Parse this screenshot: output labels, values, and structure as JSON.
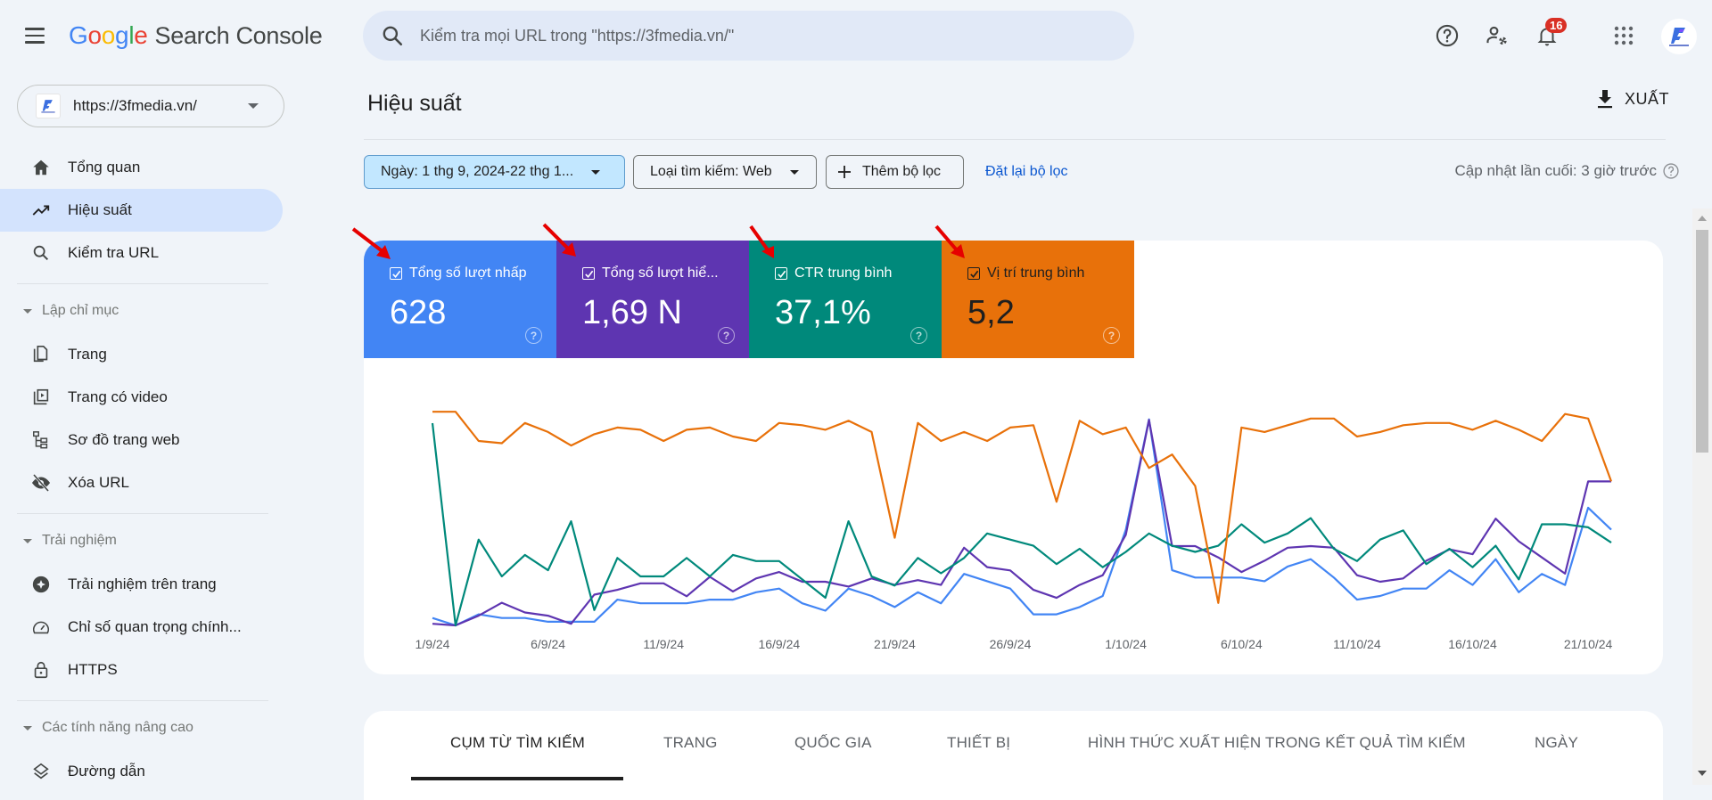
{
  "app": {
    "logo_google": [
      {
        "ch": "G",
        "color": "#4285f4"
      },
      {
        "ch": "o",
        "color": "#ea4335"
      },
      {
        "ch": "o",
        "color": "#fbbc05"
      },
      {
        "ch": "g",
        "color": "#4285f4"
      },
      {
        "ch": "l",
        "color": "#34a853"
      },
      {
        "ch": "e",
        "color": "#ea4335"
      }
    ],
    "product_name": "Search Console"
  },
  "search": {
    "placeholder": "Kiểm tra mọi URL trong \"https://3fmedia.vn/\""
  },
  "top_icons": {
    "help": "help-icon",
    "manage_users": "manage-users-icon",
    "notifications": "bell-icon",
    "notification_count": "16",
    "apps": "apps-grid-icon",
    "account": "account-avatar"
  },
  "property": {
    "url": "https://3fmedia.vn/"
  },
  "sidebar": {
    "items": [
      {
        "label": "Tổng quan",
        "icon": "home-icon"
      },
      {
        "label": "Hiệu suất",
        "icon": "trending-up-icon",
        "active": true
      },
      {
        "label": "Kiểm tra URL",
        "icon": "search-icon"
      }
    ],
    "sections": [
      {
        "title": "Lập chỉ mục",
        "items": [
          {
            "label": "Trang",
            "icon": "pages-icon"
          },
          {
            "label": "Trang có video",
            "icon": "video-pages-icon"
          },
          {
            "label": "Sơ đồ trang web",
            "icon": "sitemap-icon"
          },
          {
            "label": "Xóa URL",
            "icon": "removals-icon"
          }
        ]
      },
      {
        "title": "Trải nghiệm",
        "items": [
          {
            "label": "Trải nghiệm trên trang",
            "icon": "page-experience-icon"
          },
          {
            "label": "Chỉ số quan trọng chính...",
            "icon": "speed-gauge-icon"
          },
          {
            "label": "HTTPS",
            "icon": "lock-icon"
          }
        ]
      },
      {
        "title": "Các tính năng nâng cao",
        "items": [
          {
            "label": "Đường dẫn",
            "icon": "breadcrumbs-layers-icon"
          }
        ]
      }
    ]
  },
  "main": {
    "title": "Hiệu suất",
    "export_label": "XUẤT",
    "filters": {
      "date": "Ngày: 1 thg 9, 2024-22 thg 1...",
      "search_type": "Loại tìm kiếm: Web",
      "add_filter": "Thêm bộ lọc",
      "reset": "Đặt lại bộ lọc"
    },
    "last_updated": "Cập nhật lần cuối: 3 giờ trước",
    "metrics": [
      {
        "label": "Tổng số lượt nhấp",
        "value": "628",
        "checked": true,
        "color": "#4285f4",
        "text_color": "#ffffff"
      },
      {
        "label": "Tổng số lượt hiể...",
        "value": "1,69 N",
        "checked": true,
        "color": "#5e35b1",
        "text_color": "#ffffff"
      },
      {
        "label": "CTR trung bình",
        "value": "37,1%",
        "checked": true,
        "color": "#00897b",
        "text_color": "#ffffff"
      },
      {
        "label": "Vị trí trung bình",
        "value": "5,2",
        "checked": true,
        "color": "#e8710a",
        "text_color": "#1f1f1f"
      }
    ],
    "tabs": [
      {
        "label": "CỤM TỪ TÌM KIẾM",
        "active": true
      },
      {
        "label": "TRANG"
      },
      {
        "label": "QUỐC GIA"
      },
      {
        "label": "THIẾT BỊ"
      },
      {
        "label": "HÌNH THỨC XUẤT HIỆN TRONG KẾT QUẢ TÌM KIẾM"
      },
      {
        "label": "NGÀY"
      }
    ]
  },
  "chart_data": {
    "type": "line",
    "title": "",
    "xlabel": "",
    "ylabel": "",
    "grid": false,
    "legend": "metric cards above chart",
    "x_tick_labels": [
      "1/9/24",
      "6/9/24",
      "11/9/24",
      "16/9/24",
      "21/9/24",
      "26/9/24",
      "1/10/24",
      "6/10/24",
      "11/10/24",
      "16/10/24",
      "21/10/24"
    ],
    "x_range": [
      "1/9/24",
      "22/10/24"
    ],
    "point_count": 52,
    "series": [
      {
        "name": "Tổng số lượt nhấp",
        "color": "#4285f4",
        "axis": "clicks",
        "values": [
          4,
          2,
          5,
          4,
          4,
          3,
          3,
          3,
          9,
          8,
          8,
          8,
          9,
          9,
          11,
          12,
          8,
          6,
          12,
          10,
          7,
          11,
          8,
          16,
          14,
          12,
          5,
          5,
          7,
          10,
          28,
          58,
          17,
          15,
          15,
          15,
          14,
          18,
          20,
          15,
          9,
          10,
          12,
          12,
          17,
          13,
          20,
          11,
          16,
          13,
          34,
          28
        ]
      },
      {
        "name": "Tổng số lượt hiển thị",
        "color": "#5e35b1",
        "axis": "impressions",
        "values": [
          9,
          8,
          14,
          22,
          16,
          14,
          9,
          27,
          30,
          34,
          34,
          26,
          38,
          29,
          37,
          41,
          35,
          35,
          32,
          37,
          33,
          36,
          33,
          56,
          44,
          42,
          30,
          25,
          33,
          39,
          64,
          135,
          57,
          57,
          50,
          41,
          48,
          56,
          57,
          56,
          39,
          35,
          37,
          48,
          55,
          52,
          74,
          60,
          50,
          40,
          97,
          97
        ]
      },
      {
        "name": "CTR trung bình",
        "color": "#00897b",
        "axis": "ctr_percent",
        "values": [
          80,
          14,
          42,
          30,
          37,
          32,
          48,
          19,
          36,
          30,
          30,
          36,
          30,
          37,
          35,
          35,
          29,
          23,
          48,
          30,
          27,
          36,
          31,
          36,
          44,
          42,
          40,
          34,
          39,
          33,
          38,
          44,
          40,
          38,
          40,
          47,
          41,
          44,
          49,
          39,
          35,
          42,
          45,
          34,
          39,
          33,
          40,
          29,
          47,
          47,
          46,
          41
        ]
      },
      {
        "name": "Vị trí trung bình",
        "color": "#e8710a",
        "axis": "position",
        "values": [
          3.0,
          3.0,
          4.3,
          4.4,
          3.5,
          3.9,
          4.5,
          4.0,
          3.7,
          3.8,
          4.3,
          3.8,
          3.7,
          4.1,
          4.3,
          3.5,
          3.6,
          3.8,
          3.4,
          3.9,
          8.6,
          3.5,
          4.3,
          3.9,
          4.3,
          3.7,
          3.6,
          7.0,
          3.4,
          4.0,
          3.7,
          5.5,
          4.9,
          6.3,
          11.5,
          3.7,
          3.9,
          3.6,
          3.3,
          3.3,
          4.1,
          3.9,
          3.6,
          3.5,
          3.5,
          3.8,
          3.4,
          3.8,
          4.3,
          3.1,
          3.3,
          6.1
        ]
      }
    ]
  }
}
